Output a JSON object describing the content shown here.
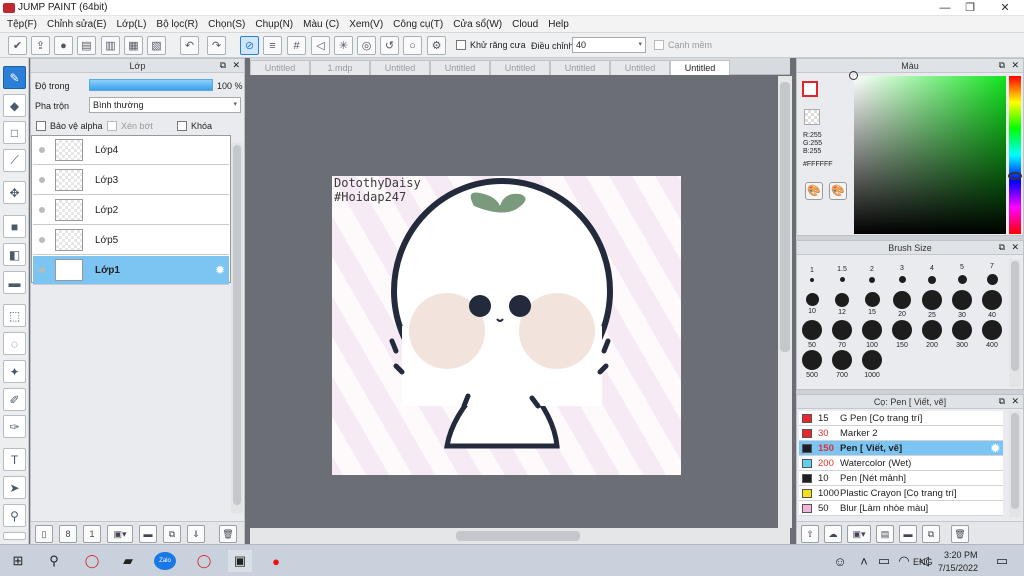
{
  "window": {
    "title": "JUMP PAINT (64bit)",
    "min": "—",
    "max": "❐",
    "close": "✕"
  },
  "menu": [
    "Tệp(F)",
    "Chỉnh sửa(E)",
    "Lớp(L)",
    "Bộ lọc(R)",
    "Chọn(S)",
    "Chụp(N)",
    "Màu (C)",
    "Xem(V)",
    "Công cụ(T)",
    "Cửa sổ(W)",
    "Cloud",
    "Help"
  ],
  "toolbar": {
    "antialias_label": "Khử răng cưa",
    "adjust_label": "Điều chỉnh",
    "adjust_value": "40",
    "snap_label": "Cạnh mềm"
  },
  "layer_panel": {
    "title": "Lớp",
    "opacity_label": "Độ trong",
    "opacity_value": "100 %",
    "blend_label": "Pha trộn",
    "blend_value": "Bình thường",
    "protect_alpha": "Bảo vệ alpha",
    "clipping": "Xén bớt",
    "lock": "Khóa",
    "layers": [
      {
        "name": "Lớp4",
        "selected": false
      },
      {
        "name": "Lớp3",
        "selected": false
      },
      {
        "name": "Lớp2",
        "selected": false
      },
      {
        "name": "Lớp5",
        "selected": false
      },
      {
        "name": "Lớp1",
        "selected": true
      }
    ]
  },
  "tabs": [
    "Untitled",
    "1.mdp",
    "Untitled",
    "Untitled",
    "Untitled",
    "Untitled",
    "Untitled",
    "Untitled"
  ],
  "canvas": {
    "watermark_line1": "DotothyDaisy",
    "watermark_line2": "#Hoidap247"
  },
  "color_panel": {
    "title": "Màu",
    "r": "R:255",
    "g": "G:255",
    "b": "B:255",
    "hex": "#FFFFFF"
  },
  "brush_size_panel": {
    "title": "Brush Size",
    "sizes": [
      "1",
      "1.5",
      "2",
      "3",
      "4",
      "5",
      "7",
      "10",
      "12",
      "15",
      "20",
      "25",
      "30",
      "40",
      "50",
      "70",
      "100",
      "150",
      "200",
      "300",
      "400",
      "500",
      "700",
      "1000"
    ]
  },
  "brush_panel": {
    "title": "Cọ: Pen [ Viết, vẽ]",
    "items": [
      {
        "size": "15",
        "name": "G Pen [Cọ trang trí]",
        "color": "#e8262b"
      },
      {
        "size": "30",
        "name": "Marker 2",
        "color": "#e8262b"
      },
      {
        "size": "150",
        "name": "Pen [ Viết, vẽ]",
        "color": "#1e1e28",
        "selected": true
      },
      {
        "size": "200",
        "name": "Watercolor (Wet)",
        "color": "#5fd0f0"
      },
      {
        "size": "10",
        "name": "Pen [Nét mảnh]",
        "color": "#1e1e28"
      },
      {
        "size": "1000",
        "name": "Plastic Crayon [Cọ trang trí]",
        "color": "#f0e020"
      },
      {
        "size": "50",
        "name": "Blur [Làm nhòe màu]",
        "color": "#f4b6d8"
      }
    ]
  },
  "taskbar": {
    "time": "3:20 PM",
    "date": "7/15/2022",
    "lang": "ENG",
    "zalo": "Zalo"
  }
}
